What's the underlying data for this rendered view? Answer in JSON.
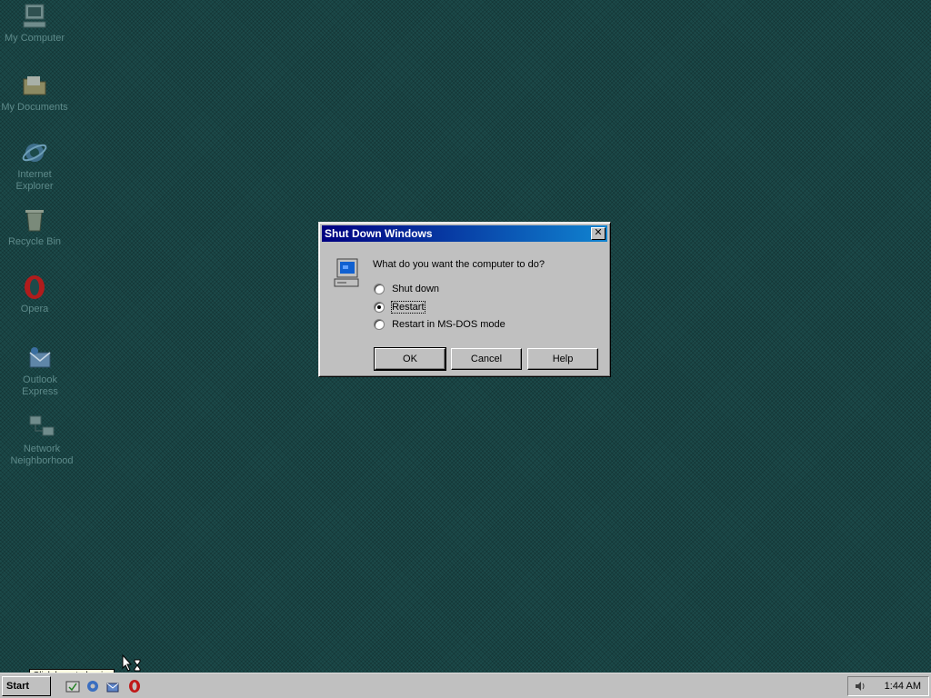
{
  "desktop": {
    "icons": [
      {
        "label": "My Computer",
        "icon": "computer-icon"
      },
      {
        "label": "My Documents",
        "icon": "folder-icon"
      },
      {
        "label": "Internet Explorer",
        "icon": "ie-icon"
      },
      {
        "label": "Recycle Bin",
        "icon": "recycle-bin-icon"
      },
      {
        "label": "Opera",
        "icon": "opera-icon"
      },
      {
        "label": "Outlook Express",
        "icon": "outlook-icon"
      },
      {
        "label": "Network Neighborhood",
        "icon": "network-icon"
      }
    ]
  },
  "dialog": {
    "title": "Shut Down Windows",
    "close_symbol": "✕",
    "question": "What do you want the computer to do?",
    "options": [
      {
        "label": "Shut down",
        "selected": false
      },
      {
        "label": "Restart",
        "selected": true
      },
      {
        "label": "Restart in MS-DOS mode",
        "selected": false
      }
    ],
    "buttons": {
      "ok": "OK",
      "cancel": "Cancel",
      "help": "Help"
    }
  },
  "taskbar": {
    "start_label": "Start",
    "tooltip": "Click here to begin.",
    "clock": "1:44 AM"
  },
  "colors": {
    "desktop": "#1c4a4a",
    "titlebar_start": "#000080",
    "titlebar_end": "#1084d0",
    "face": "#c0c0c0"
  }
}
